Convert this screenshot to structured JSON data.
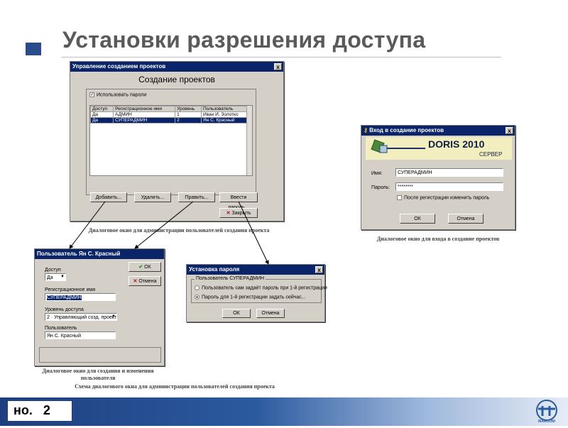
{
  "slide": {
    "title": "Установки разрешения доступа",
    "page_label": "но.",
    "page_number": "2",
    "logo_text": "MARCONI"
  },
  "win_admin": {
    "title": "Управление созданием проектов",
    "heading": "Создание проектов",
    "use_passwords": "Использовать пароли",
    "columns": [
      "Доступ",
      "Регистрационное имя",
      "Уровень",
      "Пользователь"
    ],
    "rows": [
      [
        "Да",
        "АДМИН",
        "1",
        "Иван И. Золотко"
      ],
      [
        "Да",
        "СУПЕРАДМИН",
        "2",
        "Ян С. Красный"
      ]
    ],
    "btn_add": "Добавить...",
    "btn_delete": "Удалить...",
    "btn_edit": "Править...",
    "btn_password": "Ввести пароль...",
    "btn_close": "Закрыть",
    "close_glyph": "x"
  },
  "win_user": {
    "title": "Пользователь Ян С. Красный",
    "access_label": "Доступ",
    "access_value": "Да",
    "regname_label": "Регистрационное имя",
    "regname_value": "СУПЕРАДМИН",
    "level_label": "Уровень доступа",
    "level_value": "2 · Управляющий созд. проект",
    "user_label": "Пользователь",
    "user_value": "Ян С. Красный",
    "btn_ok": "ОК",
    "btn_cancel": "Отмена"
  },
  "win_password": {
    "title": "Установка пароля",
    "group": "Пользователь СУПЕРАДМИН",
    "opt1": "Пользователь сам задаёт пароль при 1-й регистрации",
    "opt2": "Пароль для 1-й регистрации задать сейчас...",
    "btn_ok": "ОК",
    "btn_cancel": "Отмена"
  },
  "win_login": {
    "title": "Вход в создание проектов",
    "brand": "DORIS 2010",
    "brand_sub": "СЕРВЕР",
    "name_label": "Имя:",
    "name_value": "СУПЕРАДМИН",
    "pass_label": "Пароль:",
    "pass_value": "********",
    "change_pass": "После регистрации изменить пароль",
    "btn_ok": "ОК",
    "btn_cancel": "Отмена"
  },
  "captions": {
    "admin": "Диалоговое окно для администрации пользователей создания проекта",
    "login": "Диалоговое окно для входа в создание проектов",
    "user": "Диалоговое окно для создания и изменения пользователя",
    "scheme": "Схема диалогового окна для администрации пользователей создания проекта"
  },
  "colors": {
    "titlebar": "#0a246a",
    "dialog_bg": "#d4d0c8",
    "selection": "#0a246a",
    "slide_title": "#5a5a5a",
    "accent": "#2b4c8a"
  },
  "icons": {
    "title_bullet": "square-bullet-icon",
    "close": "close-x-icon",
    "ok": "checkmark-icon",
    "key": "key-icon",
    "logo": "marconi-logo-icon"
  }
}
